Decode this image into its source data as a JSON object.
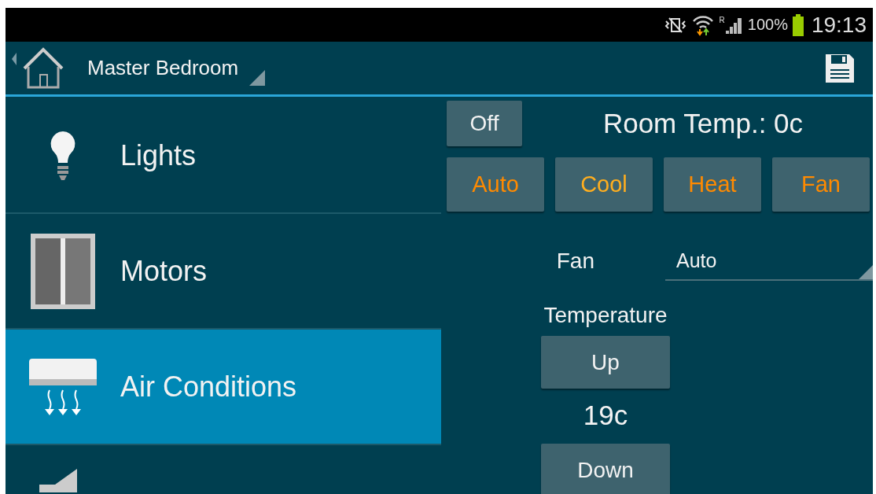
{
  "status_bar": {
    "network_type": "R",
    "battery": "100%",
    "time": "19:13"
  },
  "action_bar": {
    "title": "Master Bedroom"
  },
  "sidebar": {
    "items": [
      {
        "label": "Lights",
        "kind": "bulb",
        "selected": false
      },
      {
        "label": "Motors",
        "kind": "window",
        "selected": false
      },
      {
        "label": "Air Conditions",
        "kind": "ac",
        "selected": true
      },
      {
        "kind": "speaker",
        "selected": false
      }
    ]
  },
  "power_button": "Off",
  "room_temp": "Room Temp.: 0c",
  "modes": [
    {
      "label": "Auto",
      "selected": false
    },
    {
      "label": "Cool",
      "selected": true
    },
    {
      "label": "Heat",
      "selected": false
    },
    {
      "label": "Fan",
      "selected": false
    }
  ],
  "fan": {
    "label": "Fan",
    "value": "Auto"
  },
  "temperature": {
    "label": "Temperature",
    "up": "Up",
    "value": "19c",
    "down": "Down"
  }
}
